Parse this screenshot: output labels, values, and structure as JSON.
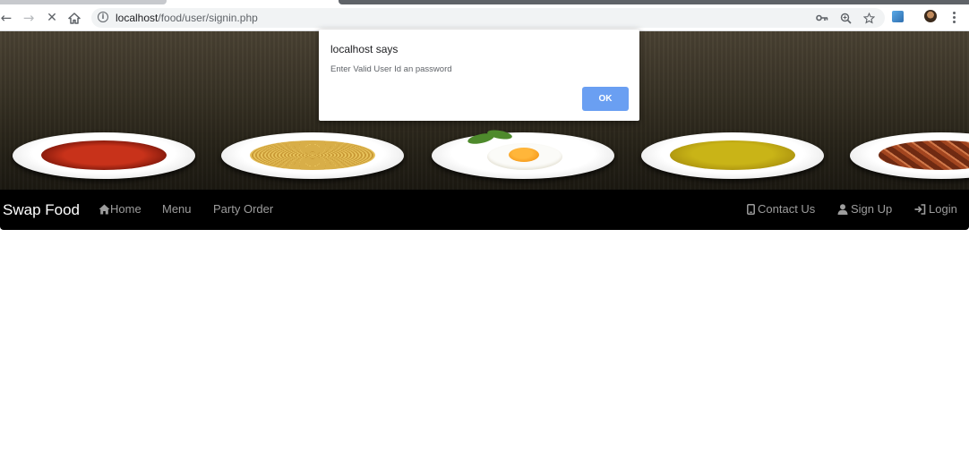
{
  "browser": {
    "url_host": "localhost",
    "url_path": "/food/user/signin.php",
    "back_icon": "back-arrow-icon",
    "forward_icon": "forward-arrow-icon",
    "stop_icon": "stop-loading-icon",
    "home_icon": "home-icon"
  },
  "hero": {
    "dishes": [
      "tomato-soup",
      "spaghetti",
      "fried-egg",
      "yellow-soup",
      "meat"
    ]
  },
  "nav": {
    "brand": "Swap Food",
    "home": "Home",
    "menu": "Menu",
    "party_order": "Party Order",
    "contact_us": "Contact Us",
    "sign_up": "Sign Up",
    "login": "Login"
  },
  "alert": {
    "title": "localhost says",
    "message": "Enter Valid User Id an password",
    "ok_label": "OK"
  },
  "colors": {
    "navbar_bg": "#000000",
    "nav_link": "#9d9d9d",
    "ok_button": "#6a9ff2"
  }
}
